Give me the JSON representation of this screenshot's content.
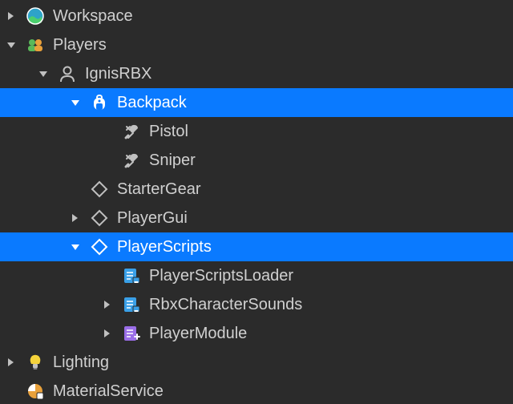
{
  "tree": [
    {
      "id": "workspace",
      "indent": 0,
      "arrow": "right",
      "icon": "workspace",
      "label": "Workspace",
      "selected": false
    },
    {
      "id": "players",
      "indent": 0,
      "arrow": "down",
      "icon": "players",
      "label": "Players",
      "selected": false
    },
    {
      "id": "ignisrbx",
      "indent": 1,
      "arrow": "down",
      "icon": "player",
      "label": "IgnisRBX",
      "selected": false
    },
    {
      "id": "backpack",
      "indent": 2,
      "arrow": "down",
      "icon": "backpack",
      "label": "Backpack",
      "selected": true
    },
    {
      "id": "pistol",
      "indent": 3,
      "arrow": "none",
      "icon": "tool",
      "label": "Pistol",
      "selected": false
    },
    {
      "id": "sniper",
      "indent": 3,
      "arrow": "none",
      "icon": "tool",
      "label": "Sniper",
      "selected": false
    },
    {
      "id": "startergear",
      "indent": 2,
      "arrow": "none",
      "icon": "diamond",
      "label": "StarterGear",
      "selected": false
    },
    {
      "id": "playergui",
      "indent": 2,
      "arrow": "right",
      "icon": "diamond",
      "label": "PlayerGui",
      "selected": false
    },
    {
      "id": "playerscripts",
      "indent": 2,
      "arrow": "down",
      "icon": "diamond",
      "label": "PlayerScripts",
      "selected": true
    },
    {
      "id": "psloader",
      "indent": 3,
      "arrow": "none",
      "icon": "localscript",
      "label": "PlayerScriptsLoader",
      "selected": false
    },
    {
      "id": "rbxcharsounds",
      "indent": 3,
      "arrow": "right",
      "icon": "localscript",
      "label": "RbxCharacterSounds",
      "selected": false
    },
    {
      "id": "playermodule",
      "indent": 3,
      "arrow": "right",
      "icon": "modulescript",
      "label": "PlayerModule",
      "selected": false
    },
    {
      "id": "lighting",
      "indent": 0,
      "arrow": "right",
      "icon": "lighting",
      "label": "Lighting",
      "selected": false
    },
    {
      "id": "materialservice",
      "indent": 0,
      "arrow": "none",
      "icon": "material",
      "label": "MaterialService",
      "selected": false
    }
  ]
}
